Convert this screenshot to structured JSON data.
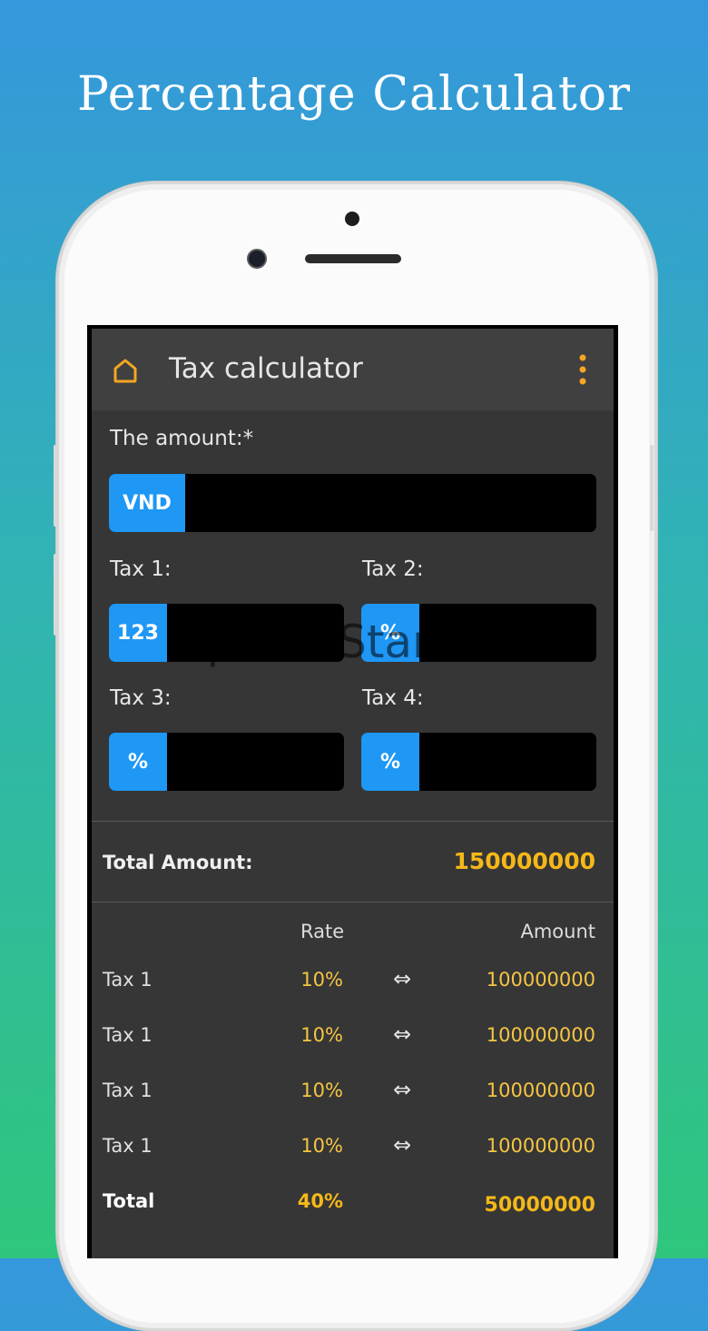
{
  "promo": {
    "title": "Percentage Calculator"
  },
  "appbar": {
    "title": "Tax calculator",
    "home_icon": "home-icon",
    "menu_icon": "more-vertical-icon"
  },
  "colors": {
    "accent": "#1e97f5",
    "highlight": "#f5b819",
    "icon": "#f5a623"
  },
  "form": {
    "amount_label": "The amount:*",
    "amount_badge": "VND",
    "tax1_label": "Tax 1:",
    "tax1_badge": "123",
    "tax2_label": "Tax 2:",
    "tax2_badge": "%",
    "tax3_label": "Tax 3:",
    "tax3_badge": "%",
    "tax4_label": "Tax 4:",
    "tax4_badge": "%"
  },
  "watermark": "UpdateStar.com",
  "summary": {
    "total_label": "Total Amount:",
    "total_value": "150000000"
  },
  "table": {
    "rate_header": "Rate",
    "amount_header": "Amount",
    "arrow_symbol": "⇔",
    "rows": [
      {
        "name": "Tax 1",
        "rate": "10%",
        "amount": "100000000"
      },
      {
        "name": "Tax 1",
        "rate": "10%",
        "amount": "100000000"
      },
      {
        "name": "Tax 1",
        "rate": "10%",
        "amount": "100000000"
      },
      {
        "name": "Tax 1",
        "rate": "10%",
        "amount": "100000000"
      }
    ],
    "total": {
      "name": "Total",
      "rate": "40%",
      "amount": "50000000"
    }
  }
}
